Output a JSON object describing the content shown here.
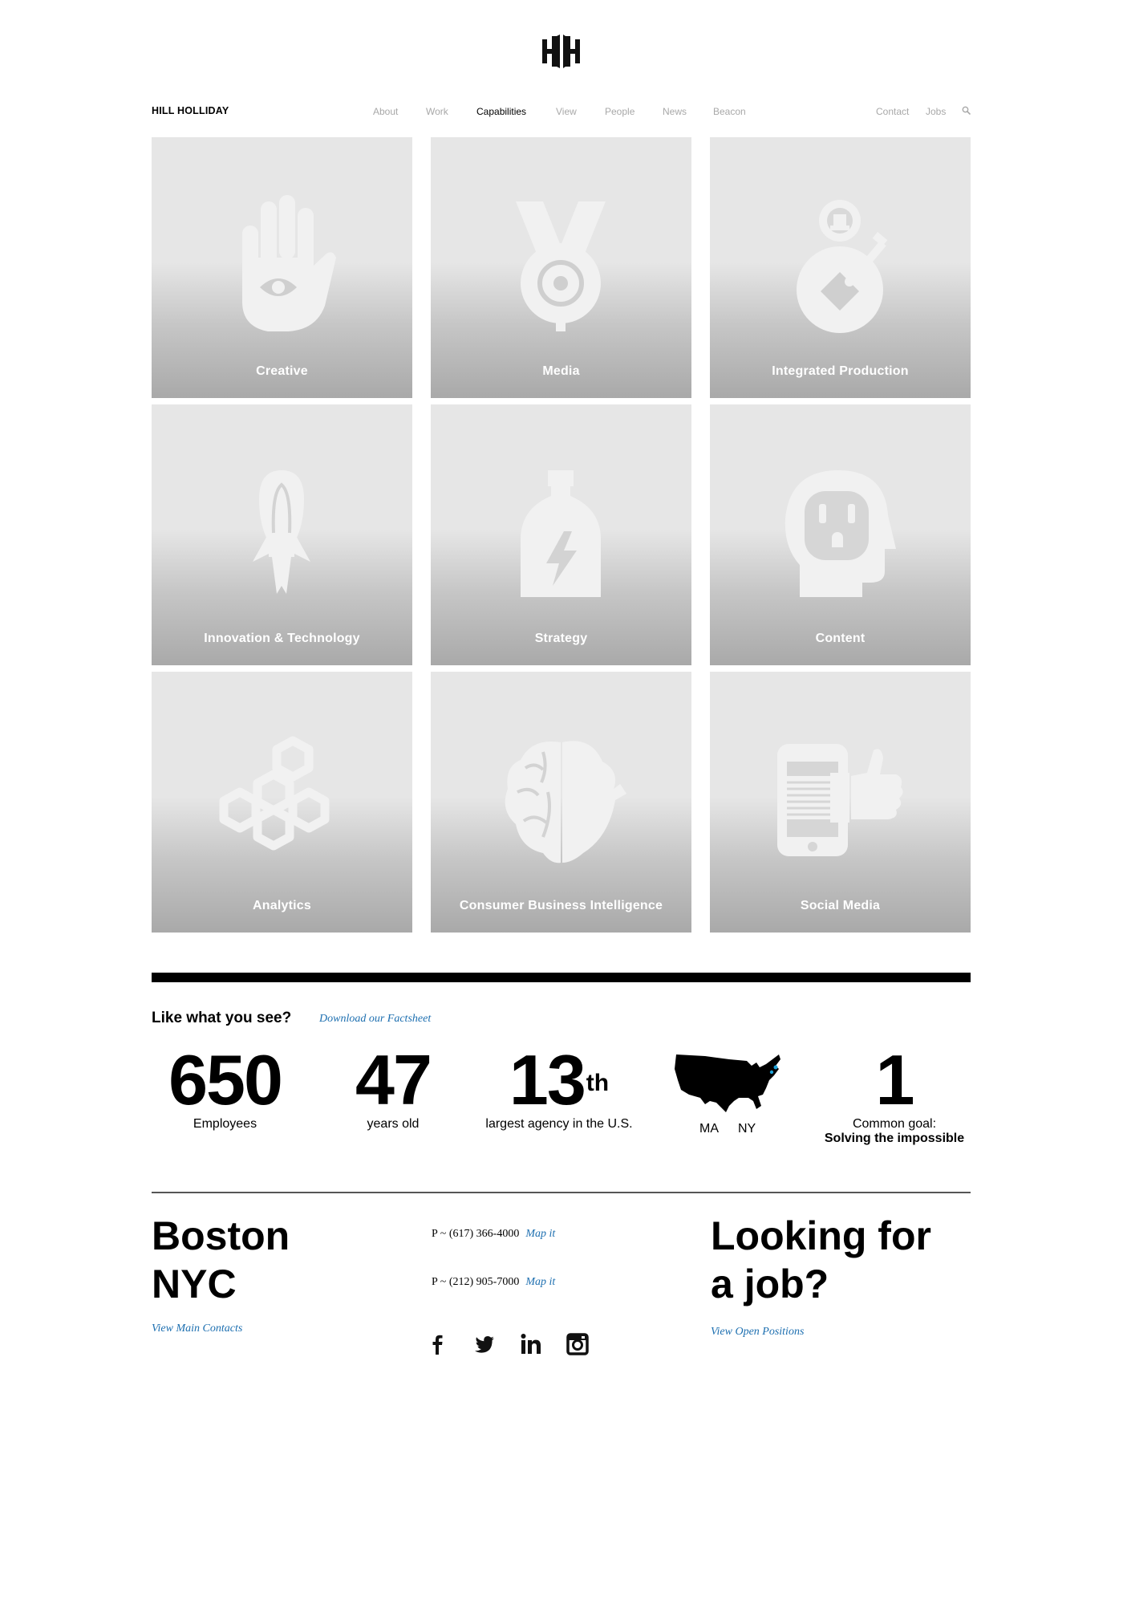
{
  "logo": {
    "icon": "hh-logo-icon"
  },
  "nav": {
    "brand": "HILL HOLLIDAY",
    "items": [
      "About",
      "Work",
      "Capabilities",
      "View",
      "People",
      "News",
      "Beacon"
    ],
    "active": "Capabilities",
    "right": [
      "Contact",
      "Jobs"
    ],
    "search_icon": "search-icon"
  },
  "tiles": [
    {
      "label": "Creative",
      "icon": "hand-eye-icon"
    },
    {
      "label": "Media",
      "icon": "medal-target-icon"
    },
    {
      "label": "Integrated Production",
      "icon": "stopwatch-puzzle-icon"
    },
    {
      "label": "Innovation & Technology",
      "icon": "lightbulb-rocket-icon"
    },
    {
      "label": "Strategy",
      "icon": "energy-bottle-icon"
    },
    {
      "label": "Content",
      "icon": "head-outlet-icon"
    },
    {
      "label": "Analytics",
      "icon": "honeycomb-icon"
    },
    {
      "label": "Consumer Business Intelligence",
      "icon": "brain-heart-icon"
    },
    {
      "label": "Social Media",
      "icon": "phone-thumbs-up-icon"
    }
  ],
  "colors": {
    "link": "#1d6fb0",
    "tile_top": "#e6e6e6",
    "tile_bottom": "#a9a9a9"
  },
  "facts": {
    "heading": "Like what you see?",
    "download": "Download our Factsheet",
    "employees": {
      "value": "650",
      "caption": "Employees"
    },
    "years": {
      "value": "47",
      "caption": "years old"
    },
    "rank": {
      "value": "13",
      "suffix": "th",
      "caption": "largest agency in the U.S."
    },
    "map": {
      "icon": "usa-map-icon",
      "ma": "MA",
      "ny": "NY"
    },
    "goal": {
      "value": "1",
      "caption": "Common goal:",
      "caption_bold": "Solving the impossible"
    }
  },
  "offices": {
    "cities": [
      "Boston",
      "NYC"
    ],
    "main_contacts": "View Main Contacts",
    "phones": [
      {
        "number": "P ~ (617) 366-4000",
        "map": "Map it"
      },
      {
        "number": "P ~ (212) 905-7000",
        "map": "Map it"
      }
    ],
    "social": [
      "facebook-icon",
      "twitter-icon",
      "linkedin-icon",
      "instagram-icon"
    ]
  },
  "jobs": {
    "line1": "Looking for",
    "line2": "a job?",
    "link": "View Open Positions"
  }
}
